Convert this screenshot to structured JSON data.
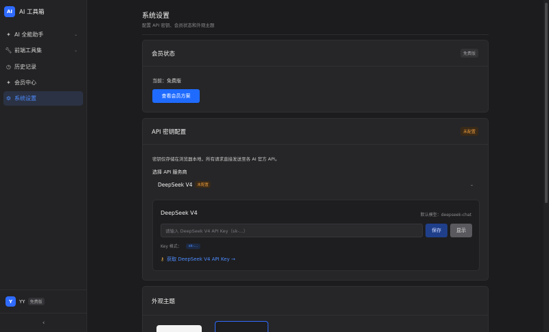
{
  "app": {
    "logo_text": "AI",
    "title": "AI 工具箱"
  },
  "sidebar": {
    "items": [
      {
        "icon": "sparkle-icon",
        "label": "AI 全能助手",
        "has_chevron": true
      },
      {
        "icon": "wrench-icon",
        "label": "前端工具集",
        "has_chevron": true
      },
      {
        "icon": "history-icon",
        "label": "历史记录",
        "has_chevron": false
      },
      {
        "icon": "sparkle-icon",
        "label": "会员中心",
        "has_chevron": false
      },
      {
        "icon": "gear-icon",
        "label": "系统设置",
        "has_chevron": false,
        "active": true
      }
    ],
    "user": {
      "avatar": "Y",
      "name": "YY",
      "plan": "免费版"
    },
    "collapse_symbol": "‹"
  },
  "page": {
    "title": "系统设置",
    "subtitle": "配置 API 密钥、会员状态和外观主题"
  },
  "membership": {
    "title": "会员状态",
    "badge": "免费版",
    "current": "当前：免费版",
    "button": "查看会员方案"
  },
  "api": {
    "title": "API 密钥配置",
    "badge": "未配置",
    "description": "密钥仅存储在浏览器本地，所有请求直接发送至各 AI 官方 API。",
    "provider_label": "选择 API 服务商",
    "provider_selected": "DeepSeek V4",
    "provider_badge": "未配置",
    "panel": {
      "title": "DeepSeek V4",
      "default_model": "默认模型：deepseek-chat",
      "placeholder": "请输入 DeepSeek V4 API Key（sk-...）",
      "save": "保存",
      "show": "显示",
      "key_format_label": "Key 格式：",
      "key_format_value": "sk-...",
      "get_key": "获取 DeepSeek V4 API Key →"
    }
  },
  "appearance": {
    "title": "外观主题"
  },
  "colors": {
    "accent": "#1f6bff",
    "warning": "#e89a3c",
    "background": "#1c1c1e",
    "card": "#262628"
  }
}
